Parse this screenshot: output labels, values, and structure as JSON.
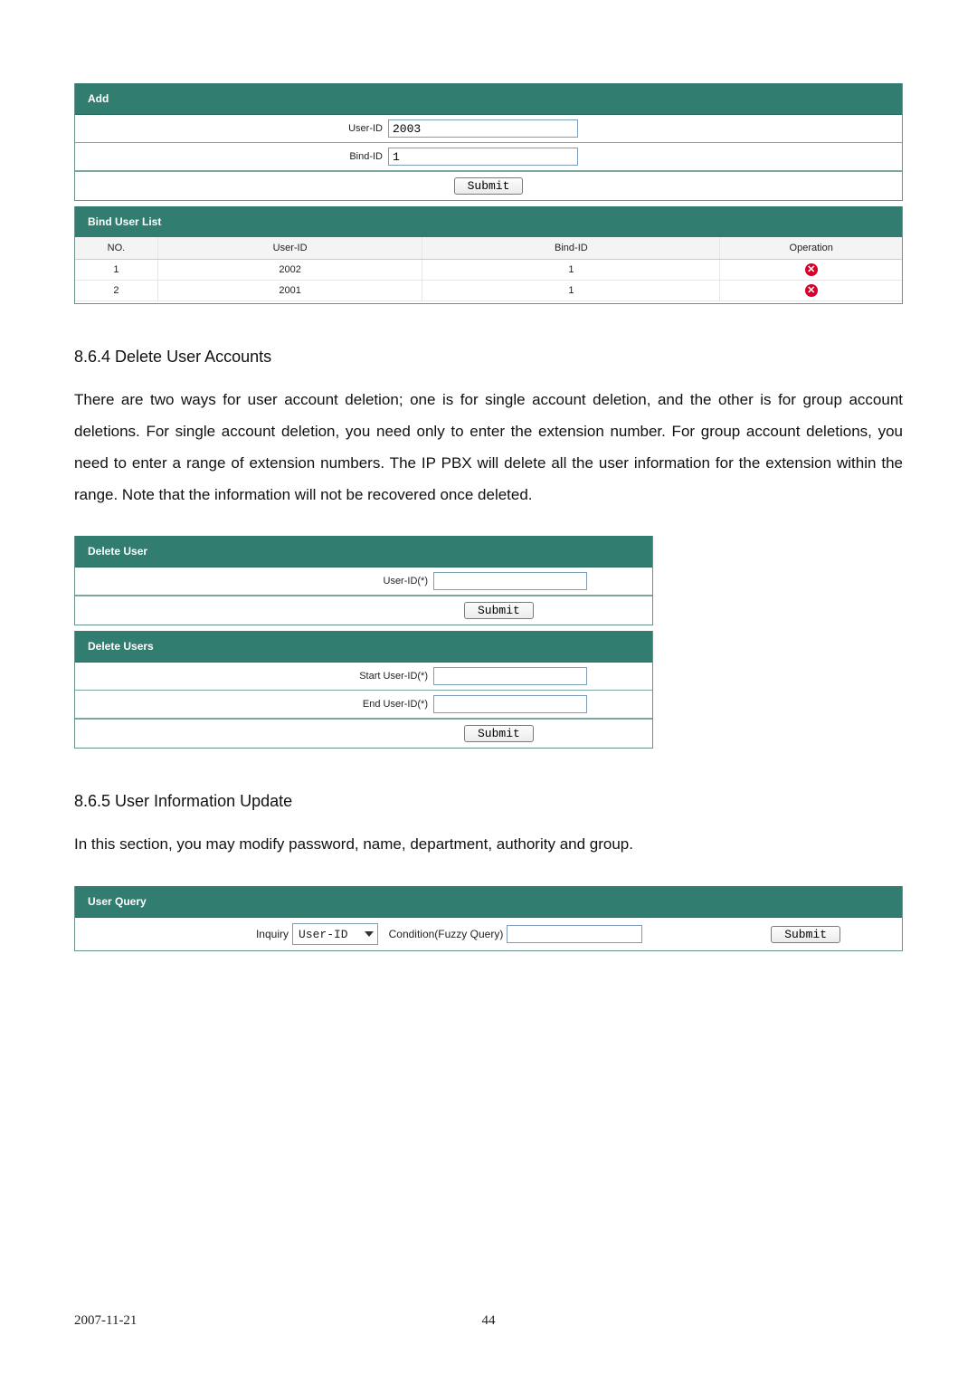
{
  "add_panel": {
    "title": "Add",
    "user_id_label": "User-ID",
    "user_id_value": "2003",
    "bind_id_label": "Bind-ID",
    "bind_id_value": "1",
    "submit": "Submit"
  },
  "bind_list": {
    "title": "Bind User List",
    "headers": {
      "no": "NO.",
      "user_id": "User-ID",
      "bind_id": "Bind-ID",
      "operation": "Operation"
    },
    "rows": [
      {
        "no": "1",
        "user_id": "2002",
        "bind_id": "1"
      },
      {
        "no": "2",
        "user_id": "2001",
        "bind_id": "1"
      }
    ]
  },
  "section_864": {
    "heading": "8.6.4 Delete User Accounts",
    "body": "There are two ways for user account deletion; one is for single account deletion, and the other is for group account deletions.   For single account deletion, you need only to enter the extension number. For group account deletions, you need to enter a range of extension numbers.  The IP PBX will delete all the user information for the extension within the range. Note that the information will not be recovered once deleted."
  },
  "delete_user": {
    "title": "Delete User",
    "user_id_label": "User-ID(*)",
    "submit": "Submit"
  },
  "delete_users": {
    "title": "Delete Users",
    "start_label": "Start User-ID(*)",
    "end_label": "End User-ID(*)",
    "submit": "Submit"
  },
  "section_865": {
    "heading": "8.6.5 User Information Update",
    "body": "In this section, you may modify password, name, department, authority and group."
  },
  "user_query": {
    "title": "User Query",
    "inquiry_label": "Inquiry",
    "inquiry_value": "User-ID",
    "condition_label": "Condition(Fuzzy Query)",
    "submit": "Submit"
  },
  "footer": {
    "date": "2007-11-21",
    "page": "44"
  }
}
